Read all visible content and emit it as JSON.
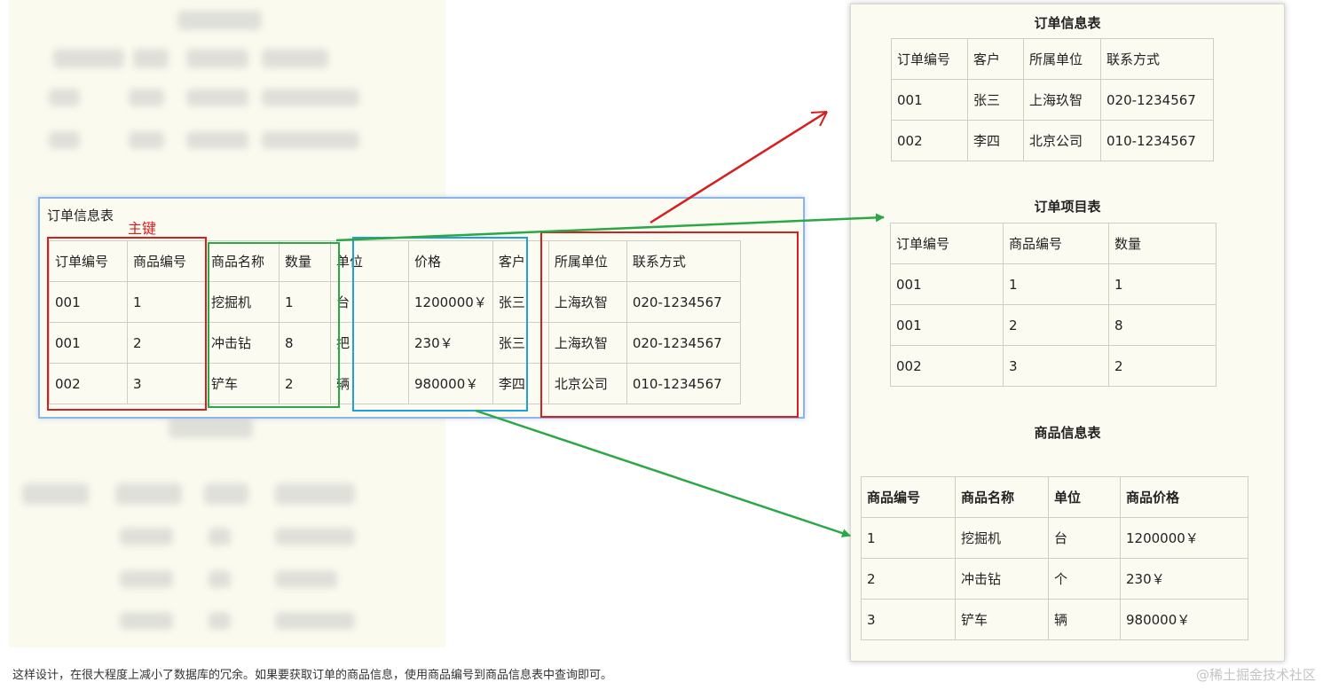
{
  "left": {
    "title": "订单信息表",
    "pk_label": "主键",
    "headers": [
      "订单编号",
      "商品编号",
      "商品名称",
      "数量",
      "单位",
      "价格",
      "客户",
      "所属单位",
      "联系方式"
    ],
    "rows": [
      [
        "001",
        "1",
        "挖掘机",
        "1",
        "台",
        "1200000￥",
        "张三",
        "上海玖智",
        "020-1234567"
      ],
      [
        "001",
        "2",
        "冲击钻",
        "8",
        "把",
        "230￥",
        "张三",
        "上海玖智",
        "020-1234567"
      ],
      [
        "002",
        "3",
        "铲车",
        "2",
        "辆",
        "980000￥",
        "李四",
        "北京公司",
        "010-1234567"
      ]
    ]
  },
  "right": {
    "order_info": {
      "title": "订单信息表",
      "headers": [
        "订单编号",
        "客户",
        "所属单位",
        "联系方式"
      ],
      "rows": [
        [
          "001",
          "张三",
          "上海玖智",
          "020-1234567"
        ],
        [
          "002",
          "李四",
          "北京公司",
          "010-1234567"
        ]
      ]
    },
    "order_items": {
      "title": "订单项目表",
      "headers": [
        "订单编号",
        "商品编号",
        "数量"
      ],
      "rows": [
        [
          "001",
          "1",
          "1"
        ],
        [
          "001",
          "2",
          "8"
        ],
        [
          "002",
          "3",
          "2"
        ]
      ]
    },
    "product_info": {
      "title": "商品信息表",
      "headers": [
        "商品编号",
        "商品名称",
        "单位",
        "商品价格"
      ],
      "rows": [
        [
          "1",
          "挖掘机",
          "台",
          "1200000￥"
        ],
        [
          "2",
          "冲击钻",
          "个",
          "230￥"
        ],
        [
          "3",
          "铲车",
          "辆",
          "980000￥"
        ]
      ]
    }
  },
  "caption": "这样设计，在很大程度上减小了数据库的冗余。如果要获取订单的商品信息，使用商品编号到商品信息表中查询即可。",
  "watermark": "@稀土掘金技术社区",
  "colors": {
    "red": "#d42020",
    "green": "#2aa846",
    "blue": "#1ea0d8",
    "panel_border": "#8db4e6"
  }
}
